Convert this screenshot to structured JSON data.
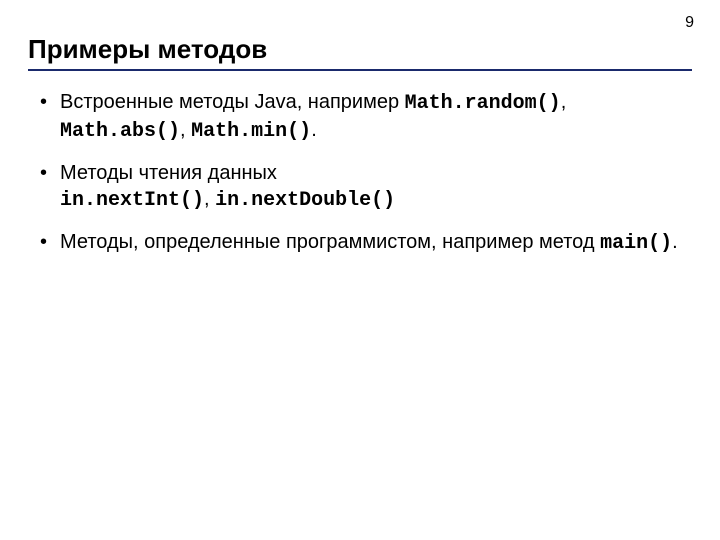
{
  "page_number": "9",
  "title": "Примеры методов",
  "bullets": [
    {
      "text_before_code1": "Встроенные методы Java, например ",
      "code1": "Math.random()",
      "sep1": ", ",
      "code2": "Math.abs()",
      "sep2": ", ",
      "code3": "Math.min()",
      "after": "."
    },
    {
      "text_before_code1": "Методы чтения данных ",
      "code1": "in.nextInt()",
      "sep1": ", ",
      "code2": "in.nextDouble()",
      "sep2": "",
      "code3": "",
      "after": ""
    },
    {
      "text_before_code1": "Методы, определенные программистом, например метод ",
      "code1": "main()",
      "sep1": "",
      "code2": "",
      "sep2": "",
      "code3": "",
      "after": "."
    }
  ]
}
